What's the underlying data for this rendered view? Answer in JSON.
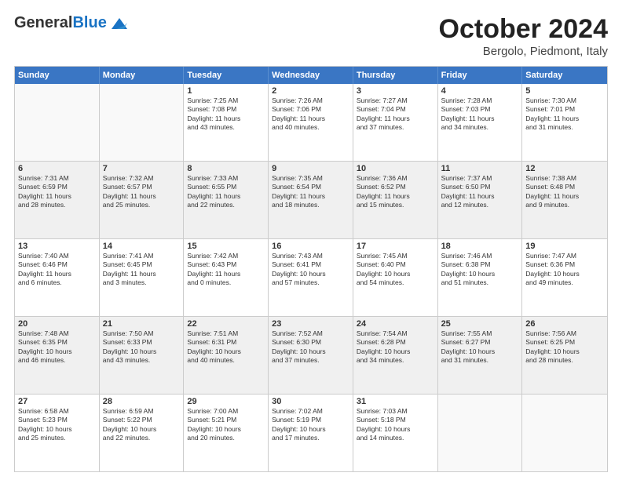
{
  "header": {
    "logo_general": "General",
    "logo_blue": "Blue",
    "month": "October 2024",
    "location": "Bergolo, Piedmont, Italy"
  },
  "days_of_week": [
    "Sunday",
    "Monday",
    "Tuesday",
    "Wednesday",
    "Thursday",
    "Friday",
    "Saturday"
  ],
  "rows": [
    [
      {
        "day": "",
        "lines": [],
        "empty": true
      },
      {
        "day": "",
        "lines": [],
        "empty": true
      },
      {
        "day": "1",
        "lines": [
          "Sunrise: 7:25 AM",
          "Sunset: 7:08 PM",
          "Daylight: 11 hours",
          "and 43 minutes."
        ]
      },
      {
        "day": "2",
        "lines": [
          "Sunrise: 7:26 AM",
          "Sunset: 7:06 PM",
          "Daylight: 11 hours",
          "and 40 minutes."
        ]
      },
      {
        "day": "3",
        "lines": [
          "Sunrise: 7:27 AM",
          "Sunset: 7:04 PM",
          "Daylight: 11 hours",
          "and 37 minutes."
        ]
      },
      {
        "day": "4",
        "lines": [
          "Sunrise: 7:28 AM",
          "Sunset: 7:03 PM",
          "Daylight: 11 hours",
          "and 34 minutes."
        ]
      },
      {
        "day": "5",
        "lines": [
          "Sunrise: 7:30 AM",
          "Sunset: 7:01 PM",
          "Daylight: 11 hours",
          "and 31 minutes."
        ]
      }
    ],
    [
      {
        "day": "6",
        "lines": [
          "Sunrise: 7:31 AM",
          "Sunset: 6:59 PM",
          "Daylight: 11 hours",
          "and 28 minutes."
        ],
        "alt": true
      },
      {
        "day": "7",
        "lines": [
          "Sunrise: 7:32 AM",
          "Sunset: 6:57 PM",
          "Daylight: 11 hours",
          "and 25 minutes."
        ],
        "alt": true
      },
      {
        "day": "8",
        "lines": [
          "Sunrise: 7:33 AM",
          "Sunset: 6:55 PM",
          "Daylight: 11 hours",
          "and 22 minutes."
        ],
        "alt": true
      },
      {
        "day": "9",
        "lines": [
          "Sunrise: 7:35 AM",
          "Sunset: 6:54 PM",
          "Daylight: 11 hours",
          "and 18 minutes."
        ],
        "alt": true
      },
      {
        "day": "10",
        "lines": [
          "Sunrise: 7:36 AM",
          "Sunset: 6:52 PM",
          "Daylight: 11 hours",
          "and 15 minutes."
        ],
        "alt": true
      },
      {
        "day": "11",
        "lines": [
          "Sunrise: 7:37 AM",
          "Sunset: 6:50 PM",
          "Daylight: 11 hours",
          "and 12 minutes."
        ],
        "alt": true
      },
      {
        "day": "12",
        "lines": [
          "Sunrise: 7:38 AM",
          "Sunset: 6:48 PM",
          "Daylight: 11 hours",
          "and 9 minutes."
        ],
        "alt": true
      }
    ],
    [
      {
        "day": "13",
        "lines": [
          "Sunrise: 7:40 AM",
          "Sunset: 6:46 PM",
          "Daylight: 11 hours",
          "and 6 minutes."
        ]
      },
      {
        "day": "14",
        "lines": [
          "Sunrise: 7:41 AM",
          "Sunset: 6:45 PM",
          "Daylight: 11 hours",
          "and 3 minutes."
        ]
      },
      {
        "day": "15",
        "lines": [
          "Sunrise: 7:42 AM",
          "Sunset: 6:43 PM",
          "Daylight: 11 hours",
          "and 0 minutes."
        ]
      },
      {
        "day": "16",
        "lines": [
          "Sunrise: 7:43 AM",
          "Sunset: 6:41 PM",
          "Daylight: 10 hours",
          "and 57 minutes."
        ]
      },
      {
        "day": "17",
        "lines": [
          "Sunrise: 7:45 AM",
          "Sunset: 6:40 PM",
          "Daylight: 10 hours",
          "and 54 minutes."
        ]
      },
      {
        "day": "18",
        "lines": [
          "Sunrise: 7:46 AM",
          "Sunset: 6:38 PM",
          "Daylight: 10 hours",
          "and 51 minutes."
        ]
      },
      {
        "day": "19",
        "lines": [
          "Sunrise: 7:47 AM",
          "Sunset: 6:36 PM",
          "Daylight: 10 hours",
          "and 49 minutes."
        ]
      }
    ],
    [
      {
        "day": "20",
        "lines": [
          "Sunrise: 7:48 AM",
          "Sunset: 6:35 PM",
          "Daylight: 10 hours",
          "and 46 minutes."
        ],
        "alt": true
      },
      {
        "day": "21",
        "lines": [
          "Sunrise: 7:50 AM",
          "Sunset: 6:33 PM",
          "Daylight: 10 hours",
          "and 43 minutes."
        ],
        "alt": true
      },
      {
        "day": "22",
        "lines": [
          "Sunrise: 7:51 AM",
          "Sunset: 6:31 PM",
          "Daylight: 10 hours",
          "and 40 minutes."
        ],
        "alt": true
      },
      {
        "day": "23",
        "lines": [
          "Sunrise: 7:52 AM",
          "Sunset: 6:30 PM",
          "Daylight: 10 hours",
          "and 37 minutes."
        ],
        "alt": true
      },
      {
        "day": "24",
        "lines": [
          "Sunrise: 7:54 AM",
          "Sunset: 6:28 PM",
          "Daylight: 10 hours",
          "and 34 minutes."
        ],
        "alt": true
      },
      {
        "day": "25",
        "lines": [
          "Sunrise: 7:55 AM",
          "Sunset: 6:27 PM",
          "Daylight: 10 hours",
          "and 31 minutes."
        ],
        "alt": true
      },
      {
        "day": "26",
        "lines": [
          "Sunrise: 7:56 AM",
          "Sunset: 6:25 PM",
          "Daylight: 10 hours",
          "and 28 minutes."
        ],
        "alt": true
      }
    ],
    [
      {
        "day": "27",
        "lines": [
          "Sunrise: 6:58 AM",
          "Sunset: 5:23 PM",
          "Daylight: 10 hours",
          "and 25 minutes."
        ]
      },
      {
        "day": "28",
        "lines": [
          "Sunrise: 6:59 AM",
          "Sunset: 5:22 PM",
          "Daylight: 10 hours",
          "and 22 minutes."
        ]
      },
      {
        "day": "29",
        "lines": [
          "Sunrise: 7:00 AM",
          "Sunset: 5:21 PM",
          "Daylight: 10 hours",
          "and 20 minutes."
        ]
      },
      {
        "day": "30",
        "lines": [
          "Sunrise: 7:02 AM",
          "Sunset: 5:19 PM",
          "Daylight: 10 hours",
          "and 17 minutes."
        ]
      },
      {
        "day": "31",
        "lines": [
          "Sunrise: 7:03 AM",
          "Sunset: 5:18 PM",
          "Daylight: 10 hours",
          "and 14 minutes."
        ]
      },
      {
        "day": "",
        "lines": [],
        "empty": true
      },
      {
        "day": "",
        "lines": [],
        "empty": true
      }
    ]
  ]
}
